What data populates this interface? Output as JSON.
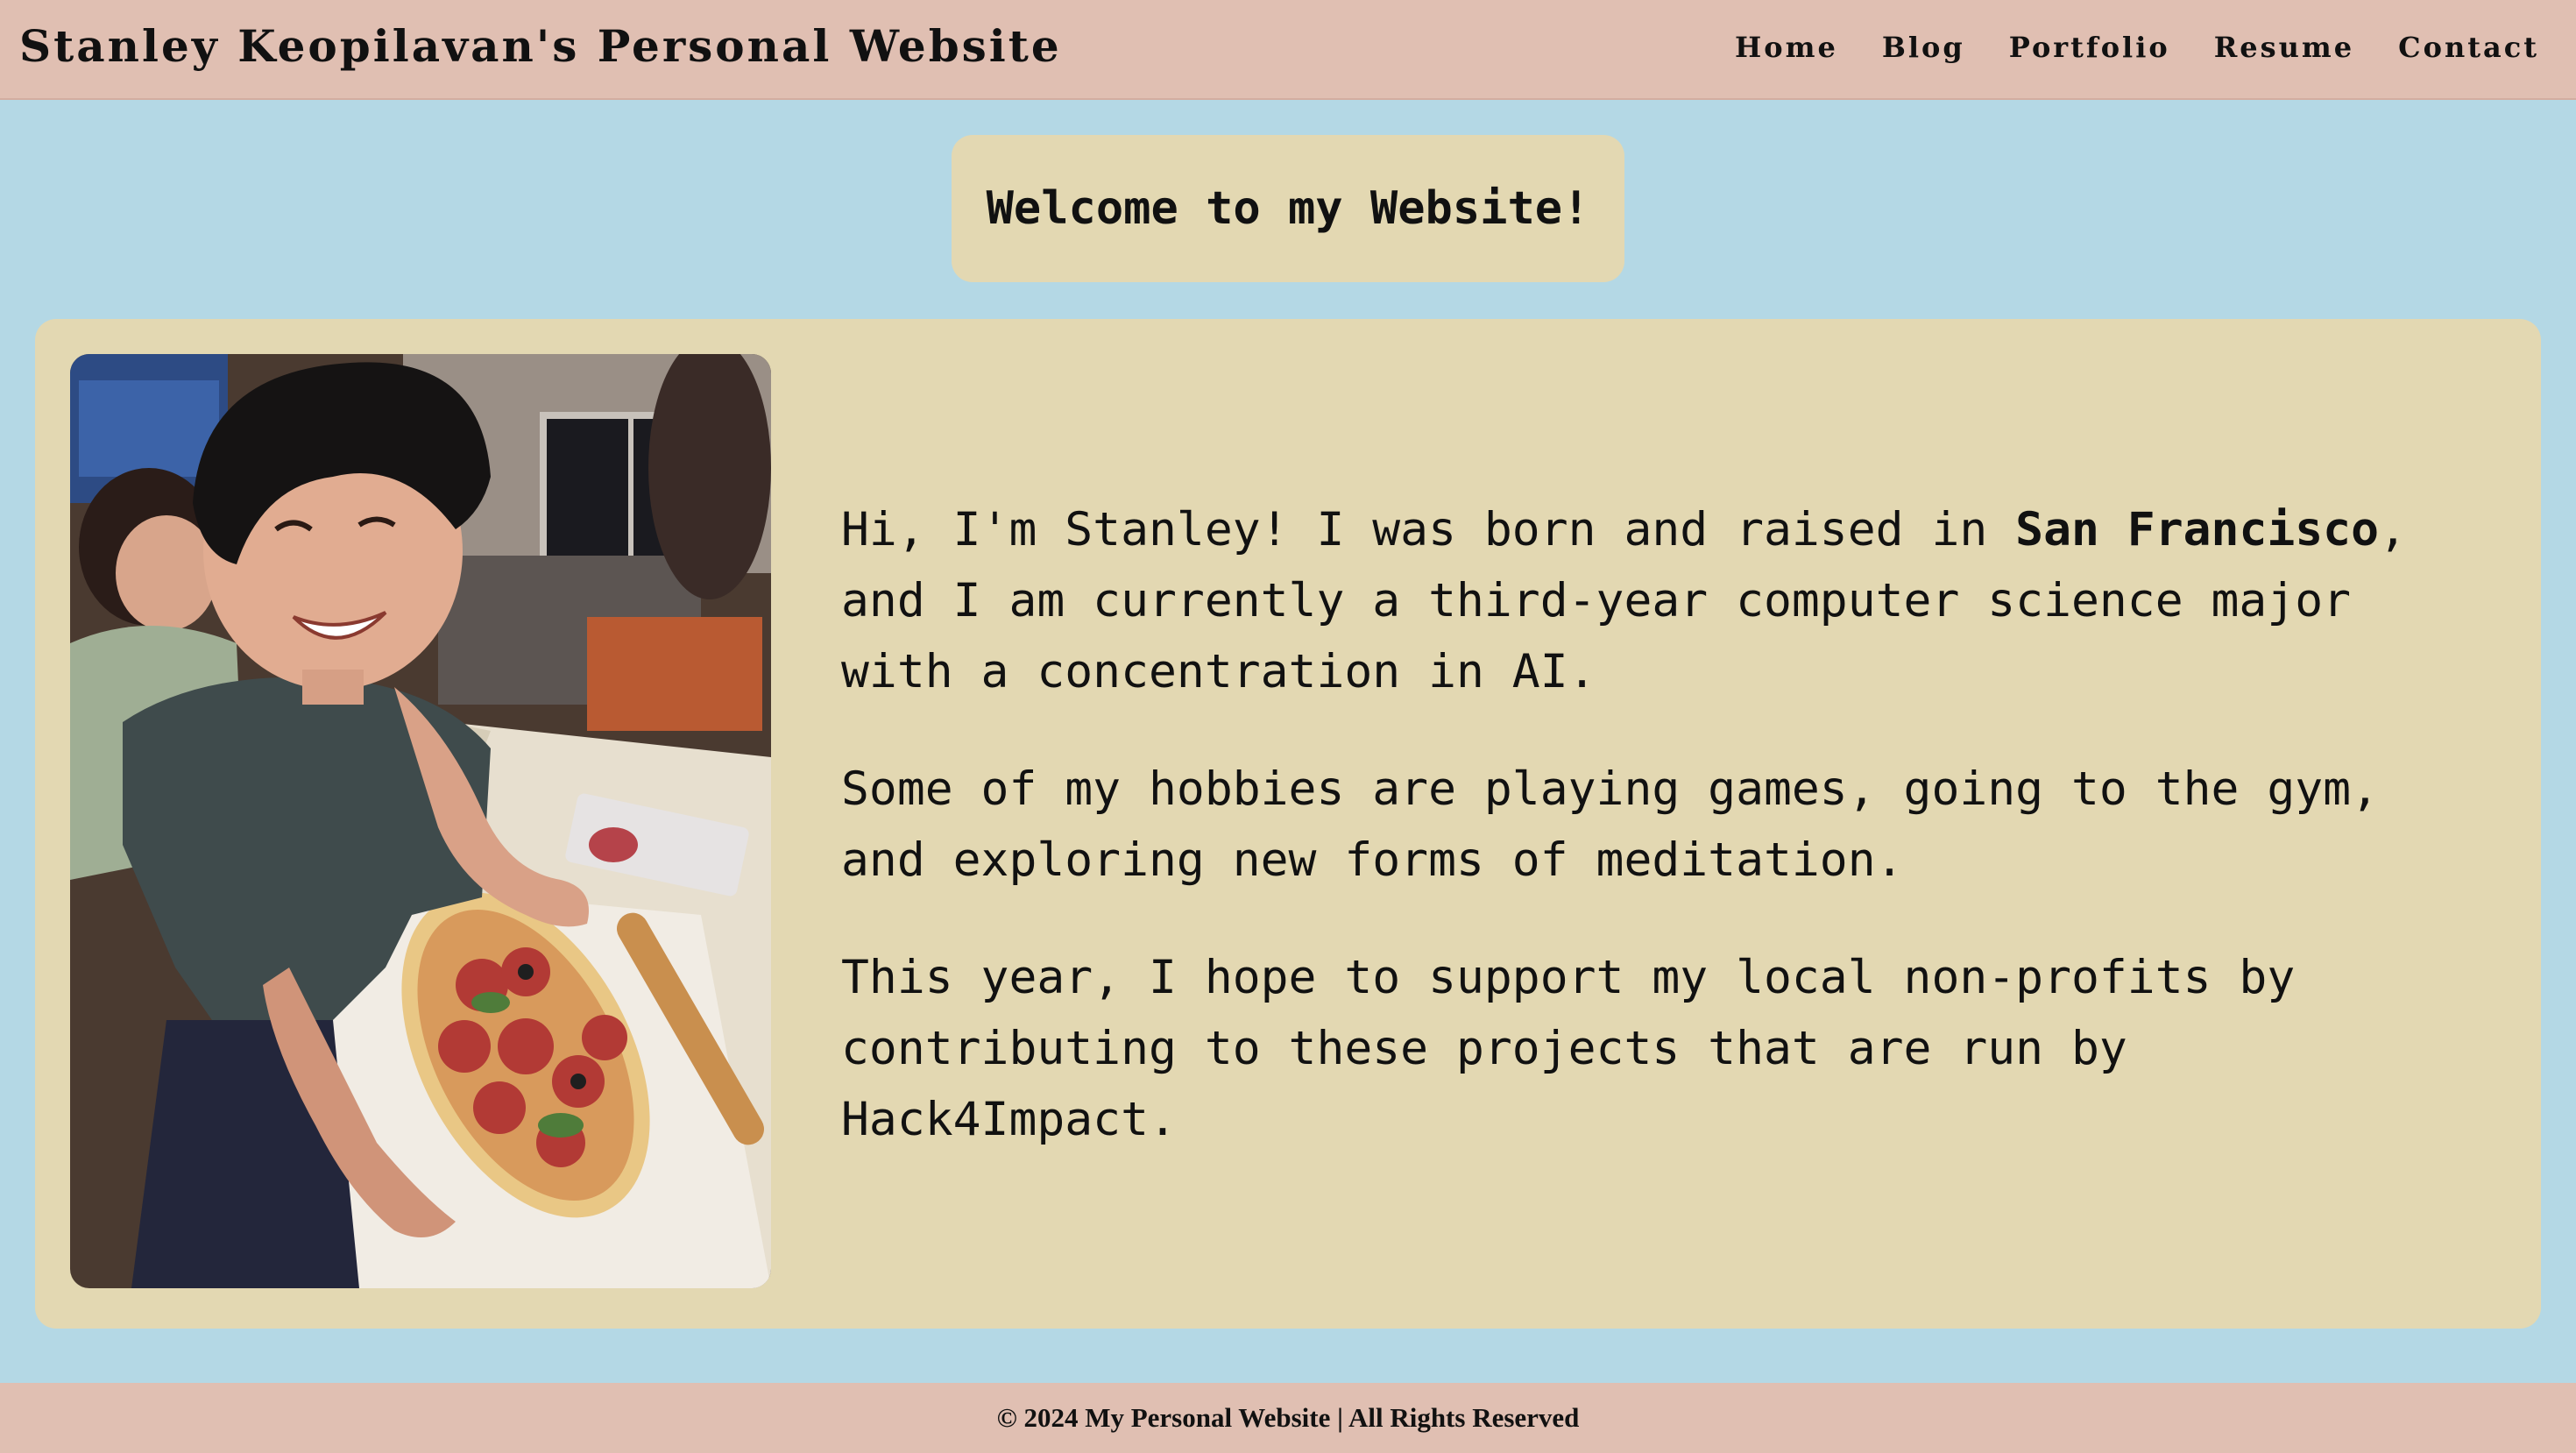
{
  "header": {
    "site_title": "Stanley Keopilavan's Personal Website",
    "nav": [
      {
        "label": "Home"
      },
      {
        "label": "Blog"
      },
      {
        "label": "Portfolio"
      },
      {
        "label": "Resume"
      },
      {
        "label": "Contact"
      }
    ]
  },
  "welcome": {
    "heading": "Welcome to my Website!"
  },
  "main": {
    "photo_alt": "Stanley smiling while making a pepperoni pizza",
    "bio": {
      "p1_before": "Hi, I'm Stanley! I was born and raised in ",
      "p1_bold": "San Francisco",
      "p1_after": ", and I am currently a third-year computer science major with a concentration in AI.",
      "p2": "Some of my hobbies are playing games, going to the gym, and exploring new forms of meditation.",
      "p3": "This year, I hope to support my local non-profits by contributing to these projects that are run by Hack4Impact."
    }
  },
  "footer": {
    "text": "© 2024 My Personal Website | All Rights Reserved"
  },
  "colors": {
    "header_bg": "#e0bfb2",
    "page_bg": "#b4d8e5",
    "card_bg": "#e3d8b2",
    "text": "#111111"
  }
}
